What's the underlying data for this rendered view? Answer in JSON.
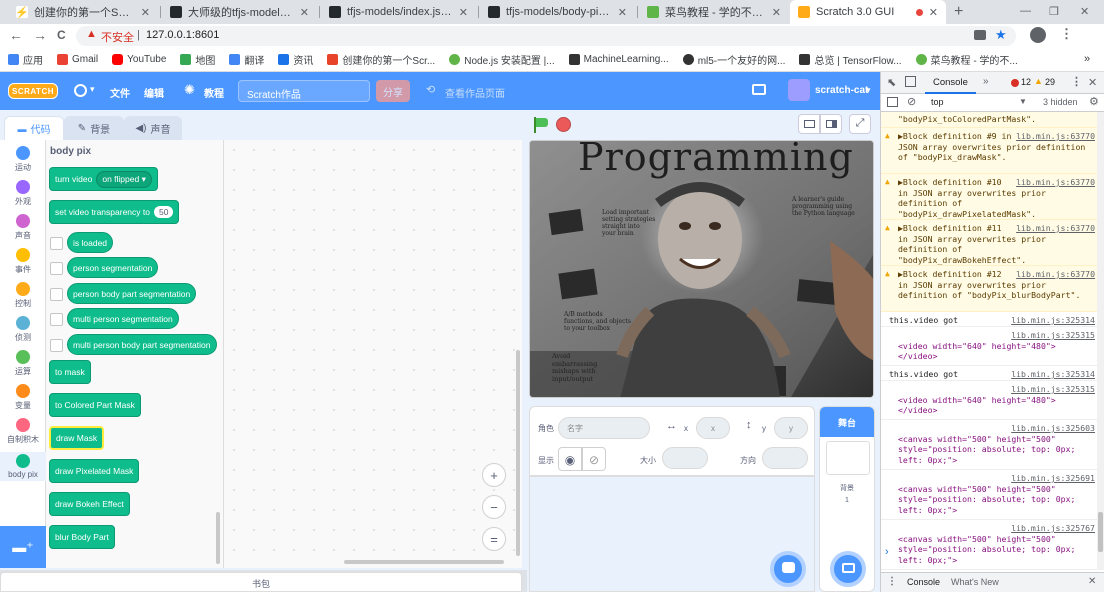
{
  "browser": {
    "tabs": [
      {
        "title": "创建你的第一个Scratch3.0 E",
        "color": "#e7442a",
        "glyph": "⚡"
      },
      {
        "title": "大师级的tfjs-models / body",
        "color": "#24292e",
        "glyph": "●"
      },
      {
        "title": "tfjs-models/index.js at ma",
        "color": "#24292e",
        "glyph": "●"
      },
      {
        "title": "tfjs-models/body-pix at m",
        "color": "#24292e",
        "glyph": "●"
      },
      {
        "title": "菜鸟教程 - 学的不仅是技术",
        "color": "#5fb548",
        "glyph": "●"
      },
      {
        "title": "Scratch 3.0 GUI",
        "color": "#ffab19",
        "glyph": "●"
      }
    ],
    "new_tab": "+",
    "window_controls": [
      "—",
      "❐",
      "✕"
    ],
    "nav": {
      "back": "←",
      "forward": "→",
      "reload": "C"
    },
    "address": {
      "security": "不安全",
      "url": "127.0.0.1:8601"
    },
    "bookmarks": [
      {
        "label": "应用",
        "color": "#4285f4"
      },
      {
        "label": "Gmail",
        "color": "#ea4335"
      },
      {
        "label": "YouTube",
        "color": "#ff0000"
      },
      {
        "label": "地图",
        "color": "#34a853"
      },
      {
        "label": "翻译",
        "color": "#4285f4"
      },
      {
        "label": "资讯",
        "color": "#1a73e8"
      },
      {
        "label": "创建你的第一个Scr...",
        "color": "#e7442a"
      },
      {
        "label": "Node.js 安装配置 |...",
        "color": "#5fb548"
      },
      {
        "label": "MachineLearning...",
        "color": "#333333"
      },
      {
        "label": "ml5-一个友好的网...",
        "color": "#333333"
      },
      {
        "label": "总览 | TensorFlow...",
        "color": "#333333"
      },
      {
        "label": "菜鸟教程 - 学的不...",
        "color": "#5fb548"
      }
    ],
    "bookmarks_more": "»"
  },
  "scratch": {
    "logo": "SCRATCH",
    "menu": {
      "globe_arrow": "▾",
      "file": "文件",
      "edit": "编辑",
      "tutorials": "教程",
      "project_title": "Scratch作品",
      "share": "分享",
      "see_project": "查看作品页面",
      "username": "scratch-cat",
      "user_arrow": "▾"
    },
    "tabs": {
      "code": "代码",
      "costumes": "背景",
      "sounds": "声音"
    },
    "categories": [
      {
        "label": "运动",
        "color": "#4c97ff"
      },
      {
        "label": "外观",
        "color": "#9966ff"
      },
      {
        "label": "声音",
        "color": "#cf63cf"
      },
      {
        "label": "事件",
        "color": "#ffbf00"
      },
      {
        "label": "控制",
        "color": "#ffab19"
      },
      {
        "label": "侦测",
        "color": "#5cb1d6"
      },
      {
        "label": "运算",
        "color": "#59c059"
      },
      {
        "label": "变量",
        "color": "#ff8c1a"
      },
      {
        "label": "自制积木",
        "color": "#ff6680"
      },
      {
        "label": "body pix",
        "color": "#0fbd8c"
      }
    ],
    "palette_title": "body pix",
    "blocks": {
      "turn_video": "turn video",
      "turn_video_option": "on flipped",
      "dropdown_arrow": "▾",
      "transparency": "set video transparency to",
      "transparency_value": "50",
      "is_loaded": "is loaded",
      "person_seg": "person segmentation",
      "person_body_part": "person body part segmentation",
      "multi_person": "multi person segmentation",
      "multi_person_body": "multi person body part segmentation",
      "to_mask": "to mask",
      "to_colored": "to Colored Part Mask",
      "draw_mask": "draw Mask",
      "draw_pixelated": "draw Pixelated Mask",
      "draw_bokeh": "draw Bokeh Effect",
      "blur_body": "blur Body Part"
    },
    "zoom": {
      "in": "+",
      "out": "−",
      "reset": "="
    },
    "backpack": "书包",
    "stage_book": {
      "title": "Programming",
      "lines": [
        "Load important",
        "setting strategies",
        "straight into",
        "your brain",
        "A learner's guide",
        "programming using",
        "the Python language",
        "A/B methods",
        "functions, and objects",
        "to your toolbox",
        "Avoid",
        "embarrassing",
        "mishaps with",
        "input/output"
      ]
    },
    "sprite": {
      "label": "角色",
      "name_placeholder": "名字",
      "x_label": "x",
      "x_value": "x",
      "y_label": "y",
      "y_value": "y",
      "show_label": "显示",
      "size_label": "大小",
      "direction_label": "方向"
    },
    "stage_panel": {
      "title": "舞台",
      "backdrops_label": "背景",
      "backdrops_count": "1"
    }
  },
  "devtools": {
    "tab": "Console",
    "more_tabs": "»",
    "errors": "12",
    "warnings": "29",
    "context": "top",
    "hidden": "3 hidden",
    "logs": [
      {
        "type": "warn-tail",
        "text": "\"bodyPix_toColoredPartMask\"."
      },
      {
        "type": "warn",
        "src": "lib.min.js:63770",
        "text": "▶Block definition #9 in JSON array overwrites prior definition of \"bodyPix_drawMask\"."
      },
      {
        "type": "warn",
        "src": "lib.min.js:63770",
        "text": "▶Block definition #10 in JSON array overwrites prior definition of \"bodyPix_drawPixelatedMask\"."
      },
      {
        "type": "warn",
        "src": "lib.min.js:63770",
        "text": "▶Block definition #11 in JSON array overwrites prior definition of \"bodyPix_drawBokehEffect\"."
      },
      {
        "type": "warn",
        "src": "lib.min.js:63770",
        "text": "▶Block definition #12 in JSON array overwrites prior definition of \"bodyPix_blurBodyPart\"."
      },
      {
        "type": "log",
        "src": "lib.min.js:325314",
        "text": "this.video got"
      },
      {
        "type": "log",
        "src": "lib.min.js:325315",
        "text": "<video width=\"640\" height=\"480\"></video>"
      },
      {
        "type": "log",
        "src": "lib.min.js:325314",
        "text": "this.video got"
      },
      {
        "type": "log",
        "src": "lib.min.js:325315",
        "text": "<video width=\"640\" height=\"480\"></video>"
      },
      {
        "type": "log",
        "src": "lib.min.js:325603",
        "text": "<canvas width=\"500\" height=\"500\" style=\"position: absolute; top: 0px; left: 0px;\">"
      },
      {
        "type": "log",
        "src": "lib.min.js:325691",
        "text": "<canvas width=\"500\" height=\"500\" style=\"position: absolute; top: 0px; left: 0px;\">"
      },
      {
        "type": "log",
        "src": "lib.min.js:325767",
        "text": "<canvas width=\"500\" height=\"500\" style=\"position: absolute; top: 0px; left: 0px;\">"
      }
    ],
    "prompt": "›",
    "drawer": {
      "console": "Console",
      "whats_new": "What's New",
      "close": "✕"
    }
  }
}
